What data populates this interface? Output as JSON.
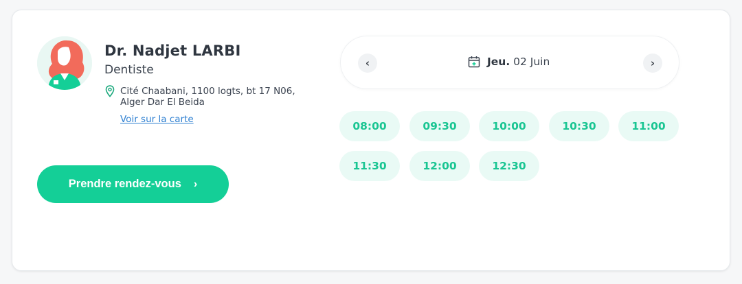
{
  "doctor": {
    "name": "Dr. Nadjet LARBI",
    "specialty": "Dentiste",
    "address_line1": "Cité Chaabani, 1100 logts, bt 17 N06,",
    "address_line2": "Alger Dar El Beida",
    "map_link": "Voir sur la carte",
    "avatar_icon": "doctor-avatar-icon"
  },
  "cta": {
    "label": "Prendre rendez-vous",
    "chevron": "›"
  },
  "date_nav": {
    "prev": "‹",
    "next": "›",
    "day": "Jeu.",
    "date": "02 Juin",
    "calendar_icon": "calendar-icon"
  },
  "slots": [
    "08:00",
    "09:30",
    "10:00",
    "10:30",
    "11:00",
    "11:30",
    "12:00",
    "12:30"
  ],
  "colors": {
    "accent": "#14cf97",
    "slot_bg": "#e9faf5",
    "slot_text": "#19c592",
    "link": "#2d7fd1",
    "avatar_hair": "#f26b5b"
  }
}
